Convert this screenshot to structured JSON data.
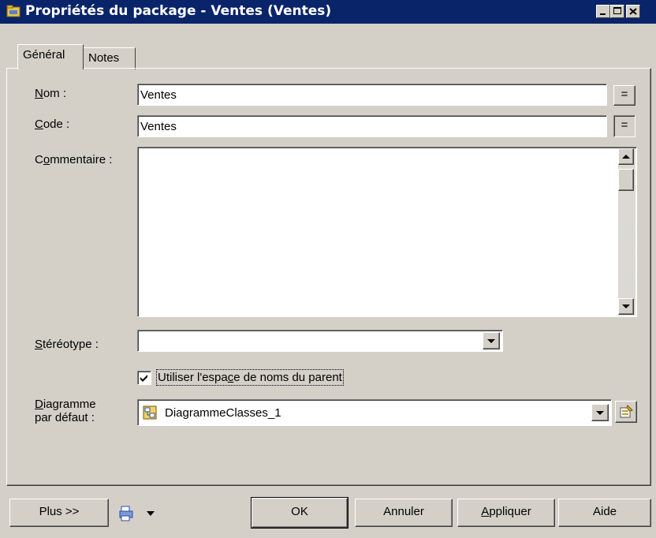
{
  "window": {
    "title": "Propriétés du package - Ventes (Ventes)",
    "buttons": {
      "minimize": "_",
      "maximize": "□",
      "close": "×"
    }
  },
  "tabs": [
    {
      "label": "Général",
      "active": true
    },
    {
      "label": "Notes",
      "active": false
    }
  ],
  "form": {
    "name": {
      "label_u": "N",
      "label_rest": "om :",
      "value": "Ventes",
      "eq_button": "="
    },
    "code": {
      "label_u": "C",
      "label_rest": "ode :",
      "value": "Ventes",
      "eq_button": "="
    },
    "comment": {
      "label_pre": "C",
      "label_u": "o",
      "label_rest": "mmentaire :",
      "value": ""
    },
    "stereotype": {
      "label_u": "S",
      "label_rest": "téréotype :",
      "value": ""
    },
    "use_parent_namespace": {
      "label_pre": "Utiliser l'espa",
      "label_u": "c",
      "label_rest": "e de noms du parent",
      "checked": true
    },
    "default_diagram": {
      "label_line1_u": "D",
      "label_line1_rest": "iagramme",
      "label_line2": "par défaut :",
      "value": "DiagrammeClasses_1"
    }
  },
  "footer": {
    "more_button": "Plus >>",
    "ok_button": "OK",
    "cancel_button": "Annuler",
    "apply_button_u": "A",
    "apply_button_rest": "ppliquer",
    "help_button": "Aide"
  },
  "colors": {
    "titlebar": "#0a246a",
    "face": "#d4d0c8",
    "field": "#ffffff"
  }
}
